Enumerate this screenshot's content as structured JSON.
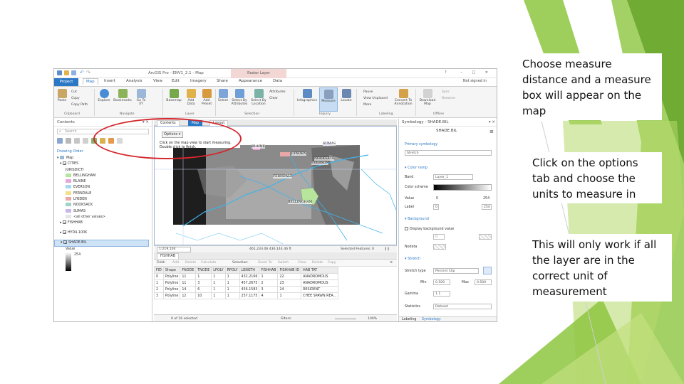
{
  "slide": {
    "callouts": [
      "Choose measure distance and a measure box will appear on the map",
      "Click on the options tab and choose the units to measure in",
      "This will only work if all the layer are in the correct unit of measurement"
    ],
    "accent_colors": [
      "#8dc63f",
      "#6aa62f",
      "#b5d96b"
    ]
  },
  "app": {
    "title": "ArcGIS Pro - ENV1_2.1 - Map",
    "context_tab": "Raster Layer",
    "help": "?",
    "signin": "Not signed in",
    "window_controls": "–  □  ✕"
  },
  "tabs": [
    "Project",
    "Map",
    "Insert",
    "Analysis",
    "View",
    "Edit",
    "Imagery",
    "Share",
    "Appearance",
    "Data"
  ],
  "ribbon": {
    "clipboard": {
      "paste": "Paste",
      "cut": "Cut",
      "copy": "Copy",
      "copy_path": "Copy Path",
      "label": "Clipboard"
    },
    "navigate": {
      "explore": "Explore",
      "bookmarks": "Bookmarks",
      "go_to_xy": "Go To XY",
      "label": "Navigate"
    },
    "layer": {
      "basemap": "Basemap",
      "add_data": "Add Data",
      "add_preset": "Add Preset",
      "label": "Layer"
    },
    "selection": {
      "select": "Select",
      "by_attributes": "Select By Attributes",
      "by_location": "Select By Location",
      "attributes": "Attributes",
      "clear": "Clear",
      "label": "Selection"
    },
    "inquiry": {
      "infographics": "Infographics",
      "measure": "Measure",
      "locate": "Locate",
      "label": "Inquiry"
    },
    "labeling": {
      "pause": "Pause",
      "view_unplaced": "View Unplaced",
      "more": "More",
      "convert": "Convert To Annotation",
      "label": "Labeling"
    },
    "offline": {
      "download": "Download Map",
      "sync": "Sync",
      "remove": "Remove",
      "label": "Offline"
    }
  },
  "contents": {
    "title": "Contents",
    "search_placeholder": "Search",
    "drawing_order": "Drawing Order",
    "items": {
      "map": "Map",
      "cities": "CITIES",
      "field": "JURISDICTI",
      "bellingham": "BELLINGHAM",
      "blaine": "BLAINE",
      "everson": "EVERSON",
      "ferndale": "FERNDALE",
      "lynden": "LYNDEN",
      "nooksack": "NOOKSACK",
      "sumas": "SUMAS",
      "other": "<all other values>",
      "fishhab": "FISHHAB",
      "hydro": "HYD4-100K",
      "shade": "SHADE.BIL",
      "value": "Value",
      "value_max": "254"
    },
    "colors": {
      "bellingham": "#b7e59b",
      "blaine": "#e6a6d8",
      "everson": "#a8d8f0",
      "ferndale": "#f3e08a",
      "lynden": "#e9a7a7",
      "nooksack": "#9fd3c7",
      "sumas": "#c9b6e8"
    }
  },
  "map": {
    "view_tabs": [
      "Contents",
      "Map",
      "Layout"
    ],
    "options": "Options",
    "measure_hint": "Click on the map view to start measuring. Double click to finish.",
    "places": [
      "BLAINE",
      "SUMAS",
      "LYNDEN",
      "NOOKSACK",
      "EVERSON",
      "FERNDALE",
      "BELLINGHAM"
    ],
    "scale": "1:219,104",
    "coords": "461,233.06 436,144.46 ft",
    "selected": "Selected Features: 0"
  },
  "attribute_table": {
    "tab": "FISHHAB",
    "toolbar": [
      "Field:",
      "Add",
      "Delete",
      "Calculate",
      "Selection:",
      "Zoom To",
      "Switch",
      "Clear",
      "Delete",
      "Copy"
    ],
    "columns": [
      "FID",
      "Shape",
      "FNODE",
      "TNODE",
      "LPOLY",
      "RPOLY",
      "LENGTH",
      "FISHHAB",
      "FISHHAB ID",
      "HAB TAT"
    ],
    "rows": [
      [
        "0",
        "Polyline",
        "11",
        "1",
        "1",
        "1",
        "432.2166",
        "1",
        "22",
        "ANADROMOUS"
      ],
      [
        "1",
        "Polyline",
        "11",
        "3",
        "1",
        "1",
        "457.2675",
        "2",
        "23",
        "ANADROMOUS"
      ],
      [
        "2",
        "Polyline",
        "14",
        "6",
        "1",
        "1",
        "456.1583",
        "3",
        "24",
        "RESIDENT"
      ],
      [
        "3",
        "Polyline",
        "12",
        "10",
        "1",
        "1",
        "257.1175",
        "4",
        "1",
        "CHEE SPAWN REA..."
      ]
    ],
    "footer_selected": "0 of 16 selected",
    "footer_filters": "Filters:",
    "zoom": "100%"
  },
  "symbology": {
    "title": "Symbology - SHADE.BIL",
    "layer": "SHADE.BIL",
    "primary_symbology": "Primary symbology",
    "stretch": "Stretch",
    "color_ramp": "Color ramp",
    "band": "Band",
    "band_value": "Layer_1",
    "color_scheme": "Color scheme",
    "value": "Value",
    "value_min": "0",
    "value_max": "254",
    "label": "Label",
    "label_min": "0",
    "label_max": "254",
    "background": "Background",
    "display_bg": "Display background value",
    "bg_value": "0",
    "nodata": "Nodata",
    "stretch_section": "Stretch",
    "stretch_type": "Stretch type",
    "stretch_type_value": "Percent Clip",
    "min": "Min",
    "min_value": "0.500",
    "max": "Max",
    "max_value": "0.500",
    "gamma": "Gamma",
    "gamma_value": "1.1",
    "statistics": "Statistics",
    "statistics_value": "Dataset",
    "tabs": [
      "Labeling",
      "Symbology"
    ]
  }
}
